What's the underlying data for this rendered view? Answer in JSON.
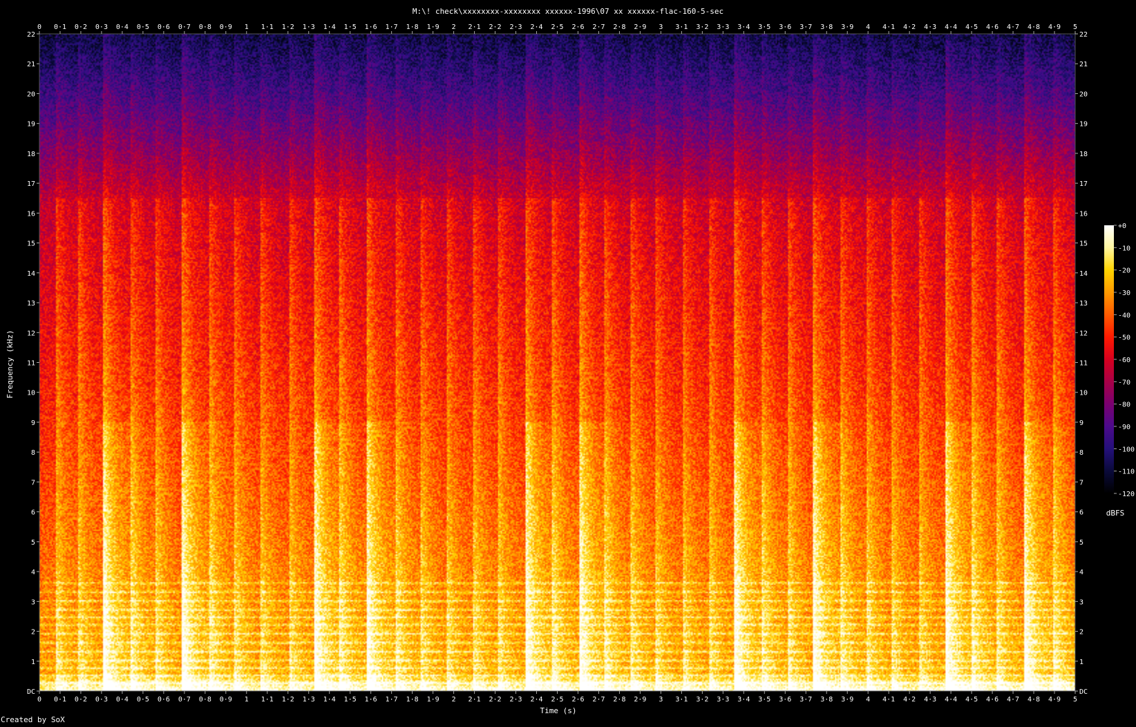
{
  "chart_data": {
    "type": "heatmap",
    "title": "M:\\! check\\xxxxxxxx-xxxxxxxx xxxxxx-1996\\07 xx xxxxxx-flac-160-5-sec",
    "xlabel": "Time (s)",
    "ylabel": "Frequency (kHz)",
    "footer": "Created by SoX",
    "xlim": [
      0,
      5
    ],
    "ylim": [
      0,
      22
    ],
    "x_ticks": [
      "0",
      "0·1",
      "0·2",
      "0·3",
      "0·4",
      "0·5",
      "0·6",
      "0·7",
      "0·8",
      "0·9",
      "1",
      "1·1",
      "1·2",
      "1·3",
      "1·4",
      "1·5",
      "1·6",
      "1·7",
      "1·8",
      "1·9",
      "2",
      "2·1",
      "2·2",
      "2·3",
      "2·4",
      "2·5",
      "2·6",
      "2·7",
      "2·8",
      "2·9",
      "3",
      "3·1",
      "3·2",
      "3·3",
      "3·4",
      "3·5",
      "3·6",
      "3·7",
      "3·8",
      "3·9",
      "4",
      "4·1",
      "4·2",
      "4·3",
      "4·4",
      "4·5",
      "4·6",
      "4·7",
      "4·8",
      "4·9",
      "5"
    ],
    "y_ticks": [
      "DC",
      "1",
      "2",
      "3",
      "4",
      "5",
      "6",
      "7",
      "8",
      "9",
      "10",
      "11",
      "12",
      "13",
      "14",
      "15",
      "16",
      "17",
      "18",
      "19",
      "20",
      "21",
      "22"
    ],
    "colorbar": {
      "label": "dBFS",
      "range": [
        -120,
        0
      ],
      "ticks": [
        "+0",
        "-10",
        "-20",
        "-30",
        "-40",
        "-50",
        "-60",
        "-70",
        "-80",
        "-90",
        "-100",
        "-110",
        "-120"
      ],
      "stops": [
        "#ffffff",
        "#fff6a0",
        "#ffd400",
        "#ff9a00",
        "#ff5a00",
        "#ff1a00",
        "#d6001e",
        "#a80046",
        "#7a0070",
        "#4c0a8c",
        "#24107a",
        "#0a0a3a",
        "#000000"
      ]
    },
    "spectrum": {
      "onsets_s": [
        0.08,
        0.19,
        0.31,
        0.44,
        0.56,
        0.69,
        0.82,
        0.94,
        1.07,
        1.21,
        1.33,
        1.45,
        1.58,
        1.72,
        1.84,
        1.97,
        2.1,
        2.22,
        2.35,
        2.48,
        2.61,
        2.73,
        2.86,
        2.98,
        3.11,
        3.24,
        3.36,
        3.49,
        3.62,
        3.74,
        3.87,
        4.0,
        4.12,
        4.25,
        4.38,
        4.51,
        4.63,
        4.76,
        4.9
      ],
      "strong_onsets_s": [
        0.31,
        0.69,
        1.33,
        1.58,
        2.35,
        2.61,
        3.36,
        3.74,
        4.38,
        4.76
      ],
      "cutoff_khz": 16.5,
      "harmonic_khz": [
        0.25,
        0.5,
        0.75,
        1.0,
        1.3,
        1.6,
        1.9,
        2.2,
        2.45,
        2.7,
        3.0,
        3.3,
        3.6
      ]
    }
  }
}
